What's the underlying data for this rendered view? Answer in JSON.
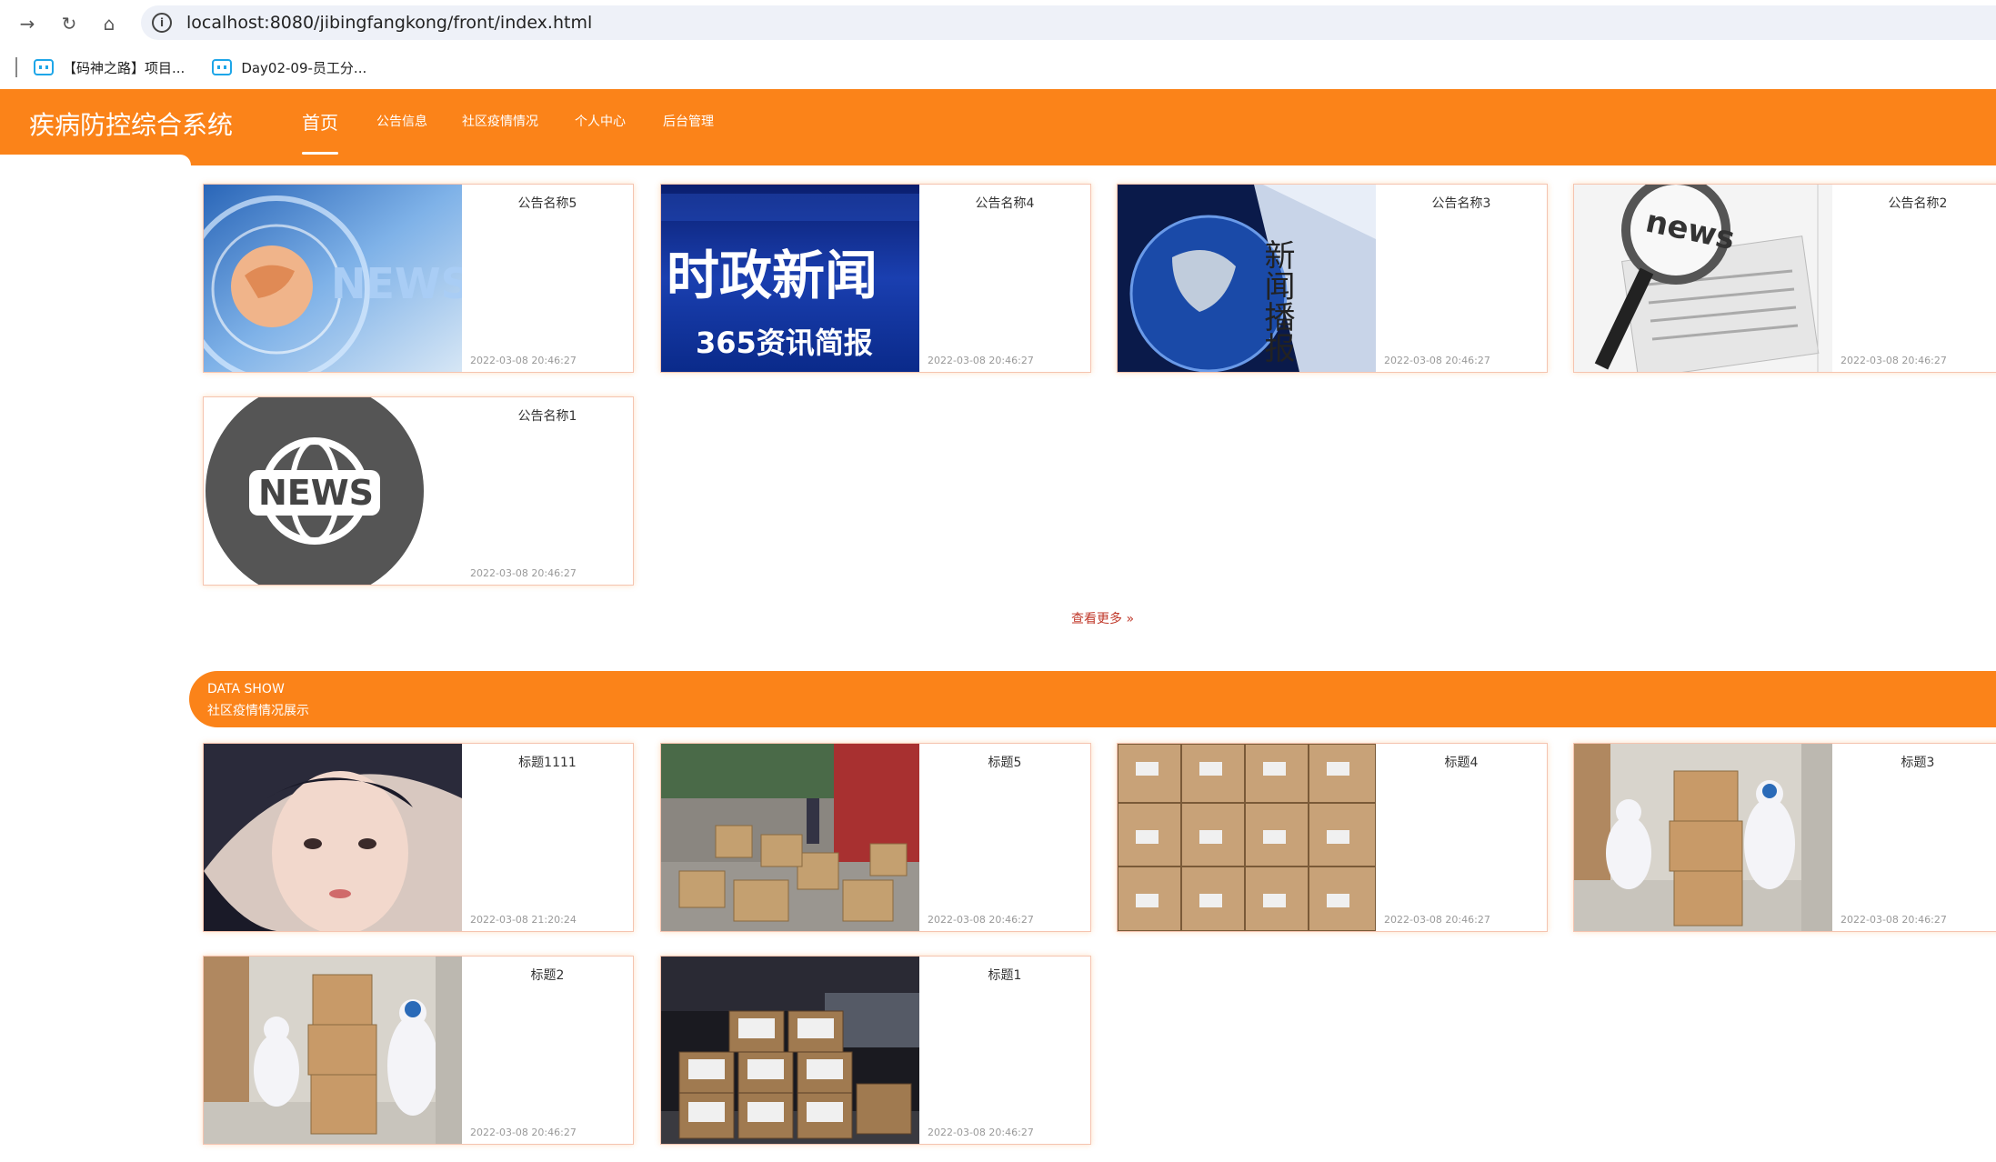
{
  "browser": {
    "url": "localhost:8080/jibingfangkong/front/index.html",
    "bookmarks": [
      {
        "label": "【码神之路】项目..."
      },
      {
        "label": "Day02-09-员工分..."
      }
    ]
  },
  "header": {
    "logo": "疾病防控综合系统",
    "nav": [
      {
        "label": "首页"
      },
      {
        "label": "公告信息"
      },
      {
        "label": "社区疫情情况"
      },
      {
        "label": "个人中心"
      },
      {
        "label": "后台管理"
      }
    ]
  },
  "notices": [
    {
      "title": "公告名称5",
      "date": "2022-03-08 20:46:27",
      "image": "news-globe-image"
    },
    {
      "title": "公告名称4",
      "date": "2022-03-08 20:46:27",
      "image": "shizheng-news-image",
      "image_text": [
        "时政新闻",
        "365资讯简报"
      ]
    },
    {
      "title": "公告名称3",
      "date": "2022-03-08 20:46:27",
      "image": "globe-broadcast-image",
      "image_text": [
        "新闻播报"
      ]
    },
    {
      "title": "公告名称2",
      "date": "2022-03-08 20:46:27",
      "image": "magnifier-newspaper-image",
      "image_text": [
        "news"
      ]
    },
    {
      "title": "公告名称1",
      "date": "2022-03-08 20:46:27",
      "image": "news-circle-icon-image",
      "image_text": [
        "NEWS"
      ]
    }
  ],
  "more_label": "查看更多 »",
  "section": {
    "en": "DATA SHOW",
    "cn": "社区疫情情况展示"
  },
  "cases": [
    {
      "title": "标题1111",
      "date": "2022-03-08 21:20:24",
      "image": "portrait-photo"
    },
    {
      "title": "标题5",
      "date": "2022-03-08 20:46:27",
      "image": "boxes-street-photo"
    },
    {
      "title": "标题4",
      "date": "2022-03-08 20:46:27",
      "image": "stacked-boxes-photo"
    },
    {
      "title": "标题3",
      "date": "2022-03-08 20:46:27",
      "image": "workers-moving-boxes-photo"
    },
    {
      "title": "标题2",
      "date": "2022-03-08 20:46:27",
      "image": "workers-moving-boxes-photo-2"
    },
    {
      "title": "标题1",
      "date": "2022-03-08 20:46:27",
      "image": "medical-supplies-boxes-photo"
    }
  ],
  "colors": {
    "accent": "#fb8319",
    "card_border": "#f5c4b0",
    "more_link": "#c0392b"
  }
}
